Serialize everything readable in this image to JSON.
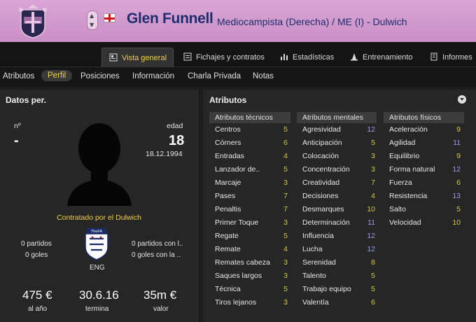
{
  "header": {
    "player_name": "Glen Funnell",
    "player_role": "Mediocampista (Derecha) / ME (I) - Dulwich",
    "flag_icon": "england-flag-icon"
  },
  "tabs": [
    {
      "label": "Vista general",
      "active": true
    },
    {
      "label": "Fichajes y contratos"
    },
    {
      "label": "Estadísticas"
    },
    {
      "label": "Entrenamiento"
    },
    {
      "label": "Informes"
    }
  ],
  "subtabs": [
    {
      "label": "Atributos"
    },
    {
      "label": "Perfil",
      "active": true
    },
    {
      "label": "Posiciones"
    },
    {
      "label": "Información"
    },
    {
      "label": "Charla Privada"
    },
    {
      "label": "Notas"
    }
  ],
  "personal": {
    "title": "Datos per.",
    "number_label": "nº",
    "number_value": "-",
    "age_label": "edad",
    "age_value": "18",
    "birth_date": "18.12.1994",
    "contract_text": "Contratado por el Dulwich",
    "matches": "0 partidos",
    "goals": "0 goles",
    "intl_matches": "0 partidos con l..",
    "intl_goals": "0 goles con la ..",
    "nation": "ENG",
    "wage": "475 €",
    "wage_label": "al año",
    "expiry": "30.6.16",
    "expiry_label": "termina",
    "value": "35m €",
    "value_label": "valor"
  },
  "attributes": {
    "title": "Atributos",
    "technical": {
      "header": "Atributos técnicos",
      "items": [
        {
          "name": "Centros",
          "value": "5",
          "color": "#d6c84a"
        },
        {
          "name": "Córners",
          "value": "6",
          "color": "#d6c84a"
        },
        {
          "name": "Entradas",
          "value": "4",
          "color": "#d6c84a"
        },
        {
          "name": "Lanzador de..",
          "value": "5",
          "color": "#d6c84a"
        },
        {
          "name": "Marcaje",
          "value": "3",
          "color": "#d6c84a"
        },
        {
          "name": "Pases",
          "value": "7",
          "color": "#d6c84a"
        },
        {
          "name": "Penaltis",
          "value": "7",
          "color": "#d6c84a"
        },
        {
          "name": "Primer Toque",
          "value": "3",
          "color": "#d6c84a"
        },
        {
          "name": "Regate",
          "value": "5",
          "color": "#d6c84a"
        },
        {
          "name": "Remate",
          "value": "4",
          "color": "#d6c84a"
        },
        {
          "name": "Remates cabeza",
          "value": "3",
          "color": "#d6c84a"
        },
        {
          "name": "Saques largos",
          "value": "3",
          "color": "#d6c84a"
        },
        {
          "name": "Técnica",
          "value": "5",
          "color": "#d6c84a"
        },
        {
          "name": "Tiros lejanos",
          "value": "3",
          "color": "#d6c84a"
        }
      ]
    },
    "mental": {
      "header": "Atributos mentales",
      "items": [
        {
          "name": "Agresividad",
          "value": "12",
          "color": "#9a9af0"
        },
        {
          "name": "Anticipación",
          "value": "5",
          "color": "#d6c84a"
        },
        {
          "name": "Colocación",
          "value": "3",
          "color": "#d6c84a"
        },
        {
          "name": "Concentración",
          "value": "3",
          "color": "#d6c84a"
        },
        {
          "name": "Creatividad",
          "value": "7",
          "color": "#d6c84a"
        },
        {
          "name": "Decisiones",
          "value": "4",
          "color": "#d6c84a"
        },
        {
          "name": "Desmarques",
          "value": "10",
          "color": "#d6c84a"
        },
        {
          "name": "Determinación",
          "value": "11",
          "color": "#9a9af0"
        },
        {
          "name": "Influencia",
          "value": "12",
          "color": "#9a9af0"
        },
        {
          "name": "Lucha",
          "value": "12",
          "color": "#9a9af0"
        },
        {
          "name": "Serenidad",
          "value": "8",
          "color": "#d6c84a"
        },
        {
          "name": "Talento",
          "value": "5",
          "color": "#d6c84a"
        },
        {
          "name": "Trabajo equipo",
          "value": "5",
          "color": "#d6c84a"
        },
        {
          "name": "Valentía",
          "value": "6",
          "color": "#d6c84a"
        }
      ]
    },
    "physical": {
      "header": "Atributos físicos",
      "items": [
        {
          "name": "Aceleración",
          "value": "9",
          "color": "#d6c84a"
        },
        {
          "name": "Agilidad",
          "value": "11",
          "color": "#9a9af0"
        },
        {
          "name": "Equilibrio",
          "value": "9",
          "color": "#d6c84a"
        },
        {
          "name": "Forma natural",
          "value": "12",
          "color": "#9a9af0"
        },
        {
          "name": "Fuerza",
          "value": "6",
          "color": "#d6c84a"
        },
        {
          "name": "Resistencia",
          "value": "13",
          "color": "#9a9af0"
        },
        {
          "name": "Salto",
          "value": "5",
          "color": "#d6c84a"
        },
        {
          "name": "Velocidad",
          "value": "10",
          "color": "#d6c84a"
        }
      ]
    }
  }
}
